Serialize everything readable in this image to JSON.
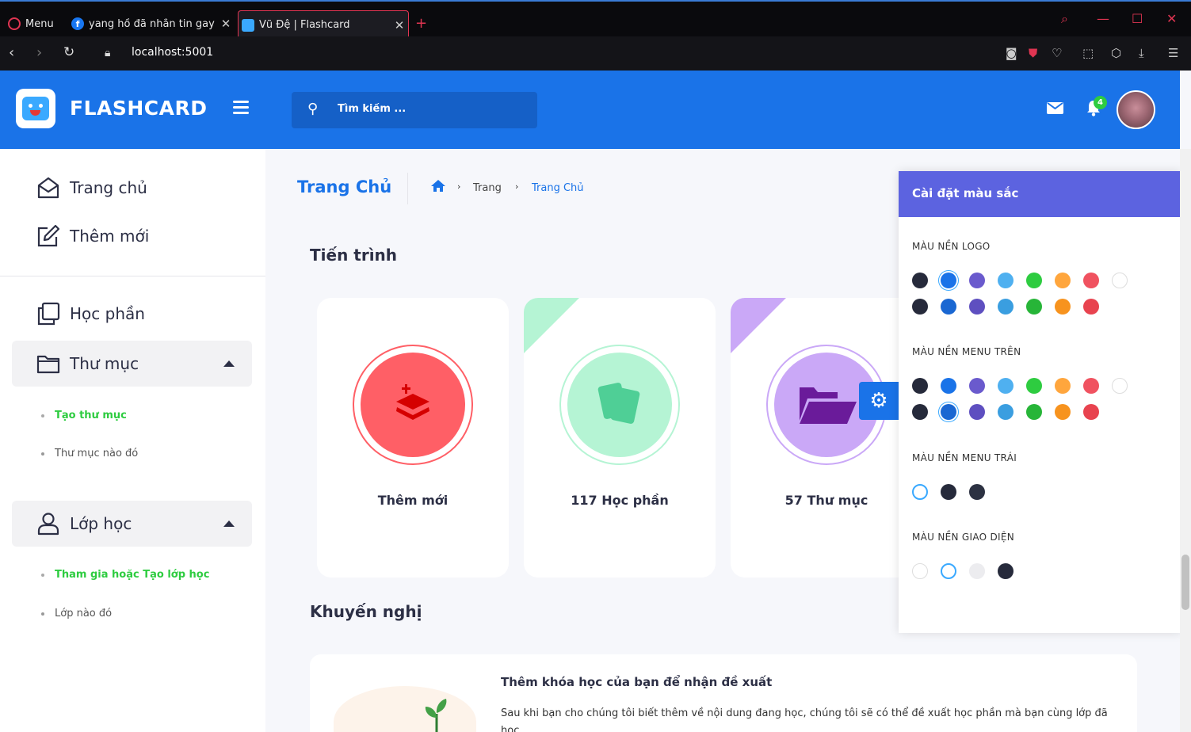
{
  "browser": {
    "menu_label": "Menu",
    "tabs": [
      {
        "title": "yang hồ đã nhắn tin gay",
        "favicon": "facebook-icon",
        "active": false
      },
      {
        "title": "Vũ Đệ | Flashcard",
        "favicon": "flashcard-favicon",
        "active": true
      }
    ],
    "url": "localhost:5001",
    "accent": "#e03552"
  },
  "header": {
    "brand": "FLASHCARD",
    "search_placeholder": "Tìm kiếm ...",
    "notification_count": "4",
    "color": "#1a73e8"
  },
  "sidebar": {
    "items": [
      {
        "label": "Trang chủ",
        "icon": "home-envelope-icon"
      },
      {
        "label": "Thêm mới",
        "icon": "edit-icon"
      },
      {
        "label": "Học phần",
        "icon": "copy-icon"
      },
      {
        "label": "Thư mục",
        "icon": "folder-icon",
        "expanded": true,
        "children": [
          {
            "label": "Tạo thư mục",
            "active": true
          },
          {
            "label": "Thư mục nào đó",
            "active": false
          }
        ]
      },
      {
        "label": "Lớp học",
        "icon": "user-icon",
        "expanded": true,
        "children": [
          {
            "label": "Tham gia hoặc Tạo lớp học",
            "active": true
          },
          {
            "label": "Lớp nào đó",
            "active": false
          }
        ]
      }
    ]
  },
  "main": {
    "page_title": "Trang Chủ",
    "breadcrumb": [
      "Trang",
      "Trang Chủ"
    ],
    "progress_heading": "Tiến trình",
    "cards": [
      {
        "label": "Thêm mới",
        "icon": "add-layers-icon",
        "color": "#ff5f66"
      },
      {
        "label": "117 Học phần",
        "icon": "cards-icon",
        "color": "#b5f4d4"
      },
      {
        "label": "57 Thư mục",
        "icon": "folder-open-icon",
        "color": "#caa8f7"
      }
    ],
    "recommend_heading": "Khuyến nghị",
    "recommend": {
      "title": "Thêm khóa học của bạn để nhận đề xuất",
      "text": "Sau khi bạn cho chúng tôi biết thêm về nội dung đang học, chúng tôi sẽ có thể đề xuất học phần mà bạn cùng lớp đã học."
    }
  },
  "settings": {
    "title": "Cài đặt màu sắc",
    "sections": [
      {
        "label": "MÀU NỀN LOGO"
      },
      {
        "label": "MÀU NỀN MENU TRÊN"
      },
      {
        "label": "MÀU NỀN MENU TRÁI"
      },
      {
        "label": "MÀU NỀN GIAO DIỆN"
      }
    ]
  }
}
